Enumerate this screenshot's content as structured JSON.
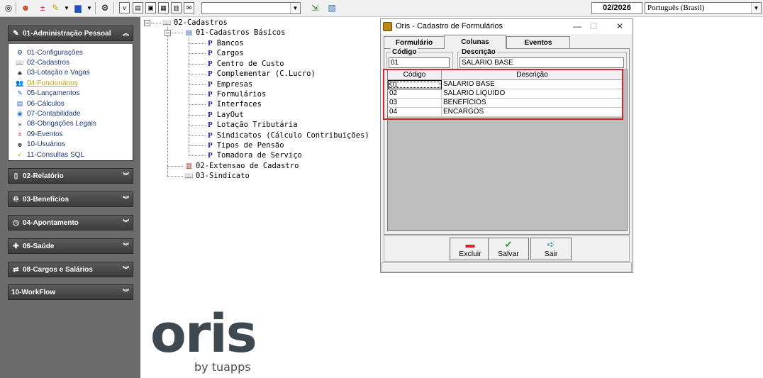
{
  "toolbar": {
    "period": "02/2026",
    "language": "Português (Brasil)",
    "combo_value": "",
    "icons": [
      "target-icon",
      "people-icon",
      "plus-minus-icon",
      "pencil-icon",
      "dropdown-arrow-icon",
      "palette-icon",
      "gear-icon",
      "small-v-icon",
      "edit-icon",
      "copy-icon",
      "paste-icon",
      "calendar-icon",
      "mail-icon",
      "exit-door-icon",
      "report-icon"
    ]
  },
  "sidebar": {
    "sections": [
      {
        "id": "adm",
        "label": "01-Administração Pessoal",
        "expanded": true,
        "icon": "pencil-icon"
      },
      {
        "id": "rel",
        "label": "02-Relatório",
        "expanded": false,
        "icon": "document-icon"
      },
      {
        "id": "ben",
        "label": "03-Benefícios",
        "expanded": false,
        "icon": "trash-icon"
      },
      {
        "id": "apo",
        "label": "04-Apontamento",
        "expanded": false,
        "icon": "clock-icon"
      },
      {
        "id": "sau",
        "label": "06-Saúde",
        "expanded": false,
        "icon": "medical-icon"
      },
      {
        "id": "car",
        "label": "08-Cargos e Salários",
        "expanded": false,
        "icon": "swap-icon"
      },
      {
        "id": "wf",
        "label": "10-WorkFlow",
        "expanded": false,
        "icon": ""
      }
    ],
    "items": [
      {
        "label": "01-Configurações",
        "icon": "gear-icon",
        "glyph": "⚙",
        "color": "#1e3a78"
      },
      {
        "label": "02-Cadastros",
        "icon": "book-icon",
        "glyph": "📖",
        "color": "#b07820"
      },
      {
        "label": "03-Lotação e Vagas",
        "icon": "org-chart-icon",
        "glyph": "♣",
        "color": "#333333"
      },
      {
        "label": "04-Funcionários",
        "icon": "users-icon",
        "glyph": "👥",
        "color": "#c9a600"
      },
      {
        "label": "05-Lançamentos",
        "icon": "pencil-icon",
        "glyph": "✎",
        "color": "#2060c0"
      },
      {
        "label": "06-Cálculos",
        "icon": "calculator-icon",
        "glyph": "▤",
        "color": "#3060c0"
      },
      {
        "label": "07-Contabilidade",
        "icon": "globe-icon",
        "glyph": "◉",
        "color": "#2a6fd0"
      },
      {
        "label": "08-Obrigações Legais",
        "icon": "double-arrow-icon",
        "glyph": "»",
        "color": "#1a1a1a"
      },
      {
        "label": "09-Eventos",
        "icon": "plus-minus-icon",
        "glyph": "±",
        "color": "#c0205a"
      },
      {
        "label": "10-Usuários",
        "icon": "user-icon",
        "glyph": "☻",
        "color": "#555555"
      },
      {
        "label": "11-Consultas SQL",
        "icon": "check-icon",
        "glyph": "✓",
        "color": "#c9a600"
      }
    ]
  },
  "tree": {
    "root": "02-Cadastros",
    "basic": "01-Cadastros Básicos",
    "leaves": [
      "Bancos",
      "Cargos",
      "Centro de Custo",
      "Complementar (C.Lucro)",
      "Empresas",
      "Formulários",
      "Interfaces",
      "LayOut",
      "Lotação Tributária",
      "Sindicatos (Cálculo Contribuições)",
      "Tipos de Pensão",
      "Tomadora de Serviço"
    ],
    "leaf_marker": "P",
    "ext": "02-Extensao de Cadastro",
    "sind": "03-Sindicato"
  },
  "dialog": {
    "title": "Oris - Cadastro de Formulários",
    "tabs": [
      "Formulário",
      "Colunas",
      "Eventos"
    ],
    "selected_tab": "Colunas",
    "codigo_label": "Código",
    "codigo_value": "01",
    "descricao_label": "Descrição",
    "descricao_value": "SALARIO BASE",
    "grid": {
      "columns": [
        "Código",
        "Descrição"
      ],
      "rows": [
        [
          "01",
          "SALARIO BASE"
        ],
        [
          "02",
          "SALARIO LIQUIDO"
        ],
        [
          "03",
          "BENEFÍCIOS"
        ],
        [
          "04",
          "ENCARGOS"
        ]
      ]
    },
    "buttons": [
      {
        "label": "Excluir",
        "icon": "minus-icon",
        "color": "#d02020"
      },
      {
        "label": "Salvar",
        "icon": "check-icon",
        "color": "#2a9a2a"
      },
      {
        "label": "Sair",
        "icon": "arrow-right-icon",
        "color": "#20a0c0"
      }
    ],
    "highlight_color": "#d4242c"
  },
  "logo": {
    "brand": "oris",
    "byline": "by tuapps"
  }
}
